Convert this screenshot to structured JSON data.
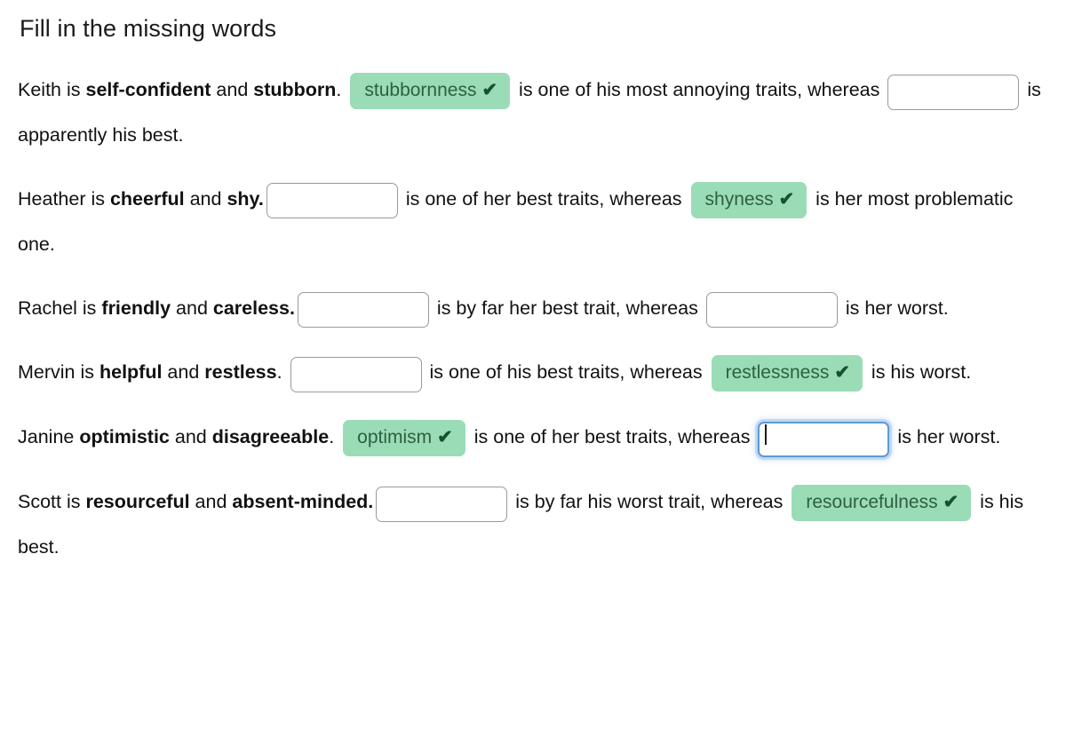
{
  "page": {
    "heading": "Fill in the missing words"
  },
  "icons": {
    "check": "✔"
  },
  "colors": {
    "chip_background": "#9adcb6",
    "chip_text": "#2e5f43",
    "check_mark": "#14532d",
    "input_border": "#9a9a9a",
    "input_focus_border": "#5b9bd5",
    "text": "#111111"
  },
  "exercises": [
    {
      "id": "keith",
      "parts": [
        {
          "type": "text",
          "value": "Keith is "
        },
        {
          "type": "bold",
          "value": "self-confident"
        },
        {
          "type": "text",
          "value": " and "
        },
        {
          "type": "bold",
          "value": "stubborn"
        },
        {
          "type": "text",
          "value": ". "
        },
        {
          "type": "answer",
          "value": "stubbornness"
        },
        {
          "type": "text",
          "value": " is one of his most annoying traits, whereas "
        },
        {
          "type": "blank",
          "value": "",
          "focused": false
        },
        {
          "type": "text",
          "value": " is apparently his best."
        }
      ]
    },
    {
      "id": "heather",
      "parts": [
        {
          "type": "text",
          "value": "Heather is "
        },
        {
          "type": "bold",
          "value": "cheerful"
        },
        {
          "type": "text",
          "value": " and "
        },
        {
          "type": "bold",
          "value": "shy."
        },
        {
          "type": "blank",
          "value": "",
          "focused": false
        },
        {
          "type": "text",
          "value": " is one of her best traits, whereas "
        },
        {
          "type": "answer",
          "value": "shyness"
        },
        {
          "type": "text",
          "value": " is her most problematic one."
        }
      ]
    },
    {
      "id": "rachel",
      "parts": [
        {
          "type": "text",
          "value": "Rachel is "
        },
        {
          "type": "bold",
          "value": "friendly"
        },
        {
          "type": "text",
          "value": " and "
        },
        {
          "type": "bold",
          "value": "careless."
        },
        {
          "type": "blank",
          "value": "",
          "focused": false
        },
        {
          "type": "text",
          "value": " is by far her best trait, whereas "
        },
        {
          "type": "blank",
          "value": "",
          "focused": false
        },
        {
          "type": "text",
          "value": " is her worst."
        }
      ]
    },
    {
      "id": "mervin",
      "parts": [
        {
          "type": "text",
          "value": "Mervin is "
        },
        {
          "type": "bold",
          "value": "helpful"
        },
        {
          "type": "text",
          "value": " and "
        },
        {
          "type": "bold",
          "value": "restless"
        },
        {
          "type": "text",
          "value": ". "
        },
        {
          "type": "blank",
          "value": "",
          "focused": false
        },
        {
          "type": "text",
          "value": " is one of his best traits, whereas "
        },
        {
          "type": "answer",
          "value": "restlessness"
        },
        {
          "type": "text",
          "value": " is his worst."
        }
      ]
    },
    {
      "id": "janine",
      "parts": [
        {
          "type": "text",
          "value": "Janine "
        },
        {
          "type": "bold",
          "value": "optimistic"
        },
        {
          "type": "text",
          "value": " and "
        },
        {
          "type": "bold",
          "value": "disagreeable"
        },
        {
          "type": "text",
          "value": ". "
        },
        {
          "type": "answer",
          "value": "optimism"
        },
        {
          "type": "text",
          "value": " is one of her best traits, whereas "
        },
        {
          "type": "blank",
          "value": "",
          "focused": true
        },
        {
          "type": "text",
          "value": " is her worst."
        }
      ]
    },
    {
      "id": "scott",
      "parts": [
        {
          "type": "text",
          "value": "Scott is "
        },
        {
          "type": "bold",
          "value": "resourceful"
        },
        {
          "type": "text",
          "value": " and "
        },
        {
          "type": "bold",
          "value": "absent-minded."
        },
        {
          "type": "blank",
          "value": "",
          "focused": false
        },
        {
          "type": "text",
          "value": " is by far his worst trait, whereas "
        },
        {
          "type": "answer",
          "value": "resourcefulness"
        },
        {
          "type": "text",
          "value": " is his best."
        }
      ]
    }
  ]
}
